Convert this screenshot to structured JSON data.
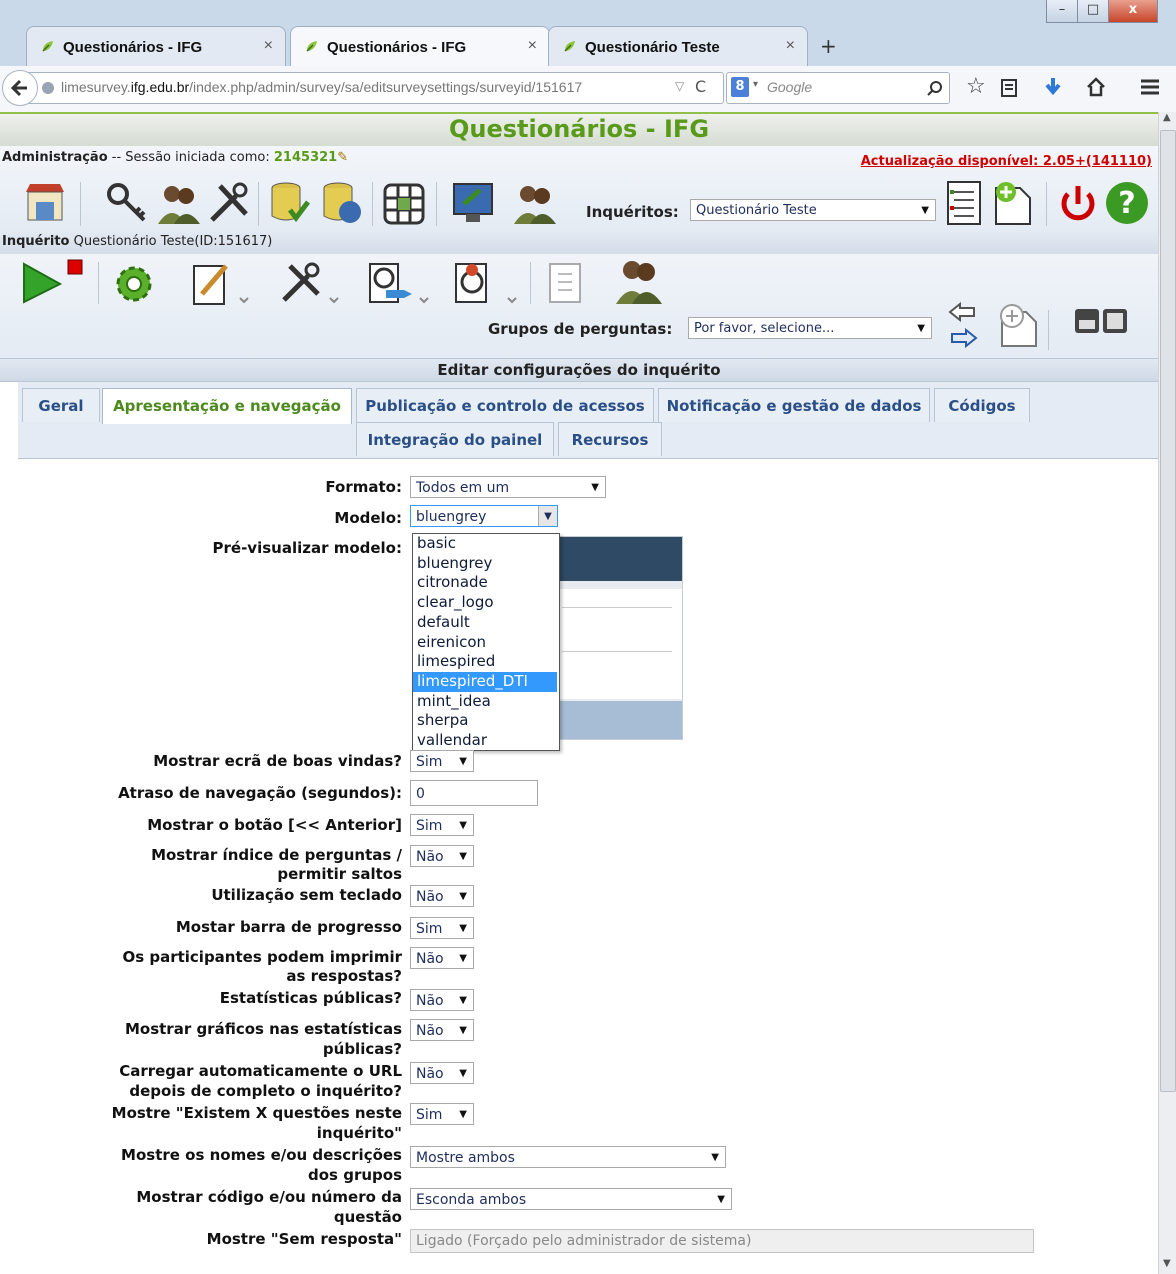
{
  "browser": {
    "tabs": [
      {
        "title": "Questionários - IFG",
        "close": "×"
      },
      {
        "title": "Questionários - IFG",
        "close": "×"
      },
      {
        "title": "Questionário Teste",
        "close": "×"
      }
    ],
    "new_tab": "+",
    "window_controls": {
      "minimize": "–",
      "maximize": "□",
      "close": "x"
    },
    "url_prefix": "limesurvey.",
    "url_domain": "ifg.edu.br",
    "url_path": "/index.php/admin/survey/sa/editsurveysettings/surveyid/151617",
    "search_placeholder": "Google",
    "search_engine_icon": "g-icon"
  },
  "header": {
    "title": "Questionários - IFG",
    "admin_label": "Administração",
    "session_text": " -- Sessão iniciada como: ",
    "user": "2145321",
    "update_notice": "Actualização disponível: 2.05+(141110)",
    "surveys_label": "Inquéritos:",
    "surveys_selected": "Questionário Teste"
  },
  "survey_bar": {
    "label": "Inquérito",
    "title": " Questionário Teste(ID:151617)",
    "groups_label": "Grupos de perguntas:",
    "groups_selected": "Por favor, selecione..."
  },
  "section_title": "Editar configurações do inquérito",
  "settings_tabs": [
    {
      "label": "Geral"
    },
    {
      "label": "Apresentação e navegação"
    },
    {
      "label": "Publicação e controlo de acessos"
    },
    {
      "label": "Notificação e gestão de dados"
    },
    {
      "label": "Códigos"
    },
    {
      "label": "Integração do painel"
    },
    {
      "label": "Recursos"
    }
  ],
  "form": {
    "formato": {
      "label": "Formato:",
      "value": "Todos em um"
    },
    "modelo": {
      "label": "Modelo:",
      "value": "bluengrey"
    },
    "preview_label": "Pré-visualizar modelo:",
    "dropdown_options": [
      "basic",
      "bluengrey",
      "citronade",
      "clear_logo",
      "default",
      "eirenicon",
      "limespired",
      "limespired_DTI",
      "mint_idea",
      "sherpa",
      "vallendar"
    ],
    "dropdown_highlighted": "limespired_DTI",
    "rows": [
      {
        "label1": "Mostrar ecrã de boas vindas?",
        "label2": "",
        "value": "Sim"
      },
      {
        "label1": "Atraso de navegação (segundos):",
        "label2": "",
        "value": "0"
      },
      {
        "label1": "Mostrar o botão [<< Anterior]",
        "label2": "",
        "value": "Sim"
      },
      {
        "label1": "Mostrar índice de perguntas /",
        "label2": "permitir saltos",
        "value": "Não"
      },
      {
        "label1": "Utilização sem teclado",
        "label2": "",
        "value": "Não"
      },
      {
        "label1": "Mostar barra de progresso",
        "label2": "",
        "value": "Sim"
      },
      {
        "label1": "Os participantes podem imprimir",
        "label2": "as respostas?",
        "value": "Não"
      },
      {
        "label1": "Estatísticas públicas?",
        "label2": "",
        "value": "Não"
      },
      {
        "label1": "Mostrar gráficos nas estatísticas",
        "label2": "públicas?",
        "value": "Não"
      },
      {
        "label1": "Carregar automaticamente o URL",
        "label2": "depois de completo o inquérito?",
        "value": "Não"
      },
      {
        "label1": "Mostre \"Existem X questões neste",
        "label2": "inquérito\"",
        "value": "Sim"
      },
      {
        "label1": "Mostre os nomes e/ou descrições",
        "label2": "dos grupos",
        "value": "Mostre ambos"
      },
      {
        "label1": "Mostrar código e/ou número da",
        "label2": "questão",
        "value": "Esconda ambos"
      },
      {
        "label1": "Mostre \"Sem resposta\"",
        "label2": "",
        "value": "Ligado (Forçado pelo administrador de sistema)"
      }
    ]
  },
  "colors": {
    "title_green": "#5a9a1a",
    "link_blue": "#2a4f86",
    "update_red": "#d00000",
    "highlight": "#3399ff"
  }
}
